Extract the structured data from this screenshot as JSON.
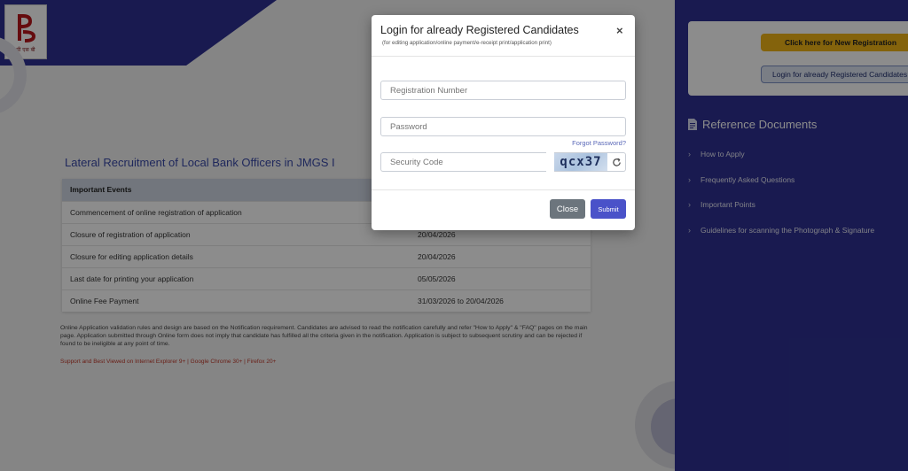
{
  "header": {
    "logo_text": "पी एस बी",
    "brand_color": "#2e3192"
  },
  "main": {
    "title": "Lateral Recruitment of Local Bank Officers in JMGS I",
    "table": {
      "headers": [
        "Important Events",
        ""
      ],
      "rows": [
        {
          "event": "Commencement of online registration of application",
          "date": ""
        },
        {
          "event": "Closure of registration of application",
          "date": "20/04/2026"
        },
        {
          "event": "Closure for editing application details",
          "date": "20/04/2026"
        },
        {
          "event": "Last date for printing your application",
          "date": "05/05/2026"
        },
        {
          "event": "Online Fee Payment",
          "date": "31/03/2026 to 20/04/2026"
        }
      ]
    },
    "notice": "Online Application validation rules and design are based on the Notification requirement. Candidates are advised to read the notification carefully and refer \"How to Apply\" & \"FAQ\" pages on the main page. Application submitted through Online form does not imply that candidate has fulfilled all the criteria given in the notification. Application is subject to subsequent scrutiny and can be rejected if found to be ineligible at any point of time.",
    "support": "Support and Best Viewed on Internet Explorer 9+ | Google Chrome 30+ | Firefox 20+"
  },
  "sidebar": {
    "new_registration_label": "Click here for New Registration",
    "login_label": "Login for already Registered Candidates",
    "reference_title": "Reference Documents",
    "reference_items": [
      {
        "label": "How to Apply"
      },
      {
        "label": "Frequently Asked Questions"
      },
      {
        "label": "Important Points"
      },
      {
        "label": "Guidelines for scanning the Photograph & Signature"
      }
    ]
  },
  "modal": {
    "title": "Login for already Registered Candidates",
    "subtitle": "(for editing application/online payment/e-receipt print/application print)",
    "close_symbol": "×",
    "registration_placeholder": "Registration Number",
    "password_placeholder": "Password",
    "forgot_password": "Forgot Password?",
    "security_code_placeholder": "Security Code",
    "captcha_text": "qcx37",
    "close_button": "Close",
    "submit_button": "Submit"
  },
  "colors": {
    "accent_yellow": "#f0b417",
    "submit_blue": "#4a52c9",
    "close_grey": "#6c757d"
  }
}
